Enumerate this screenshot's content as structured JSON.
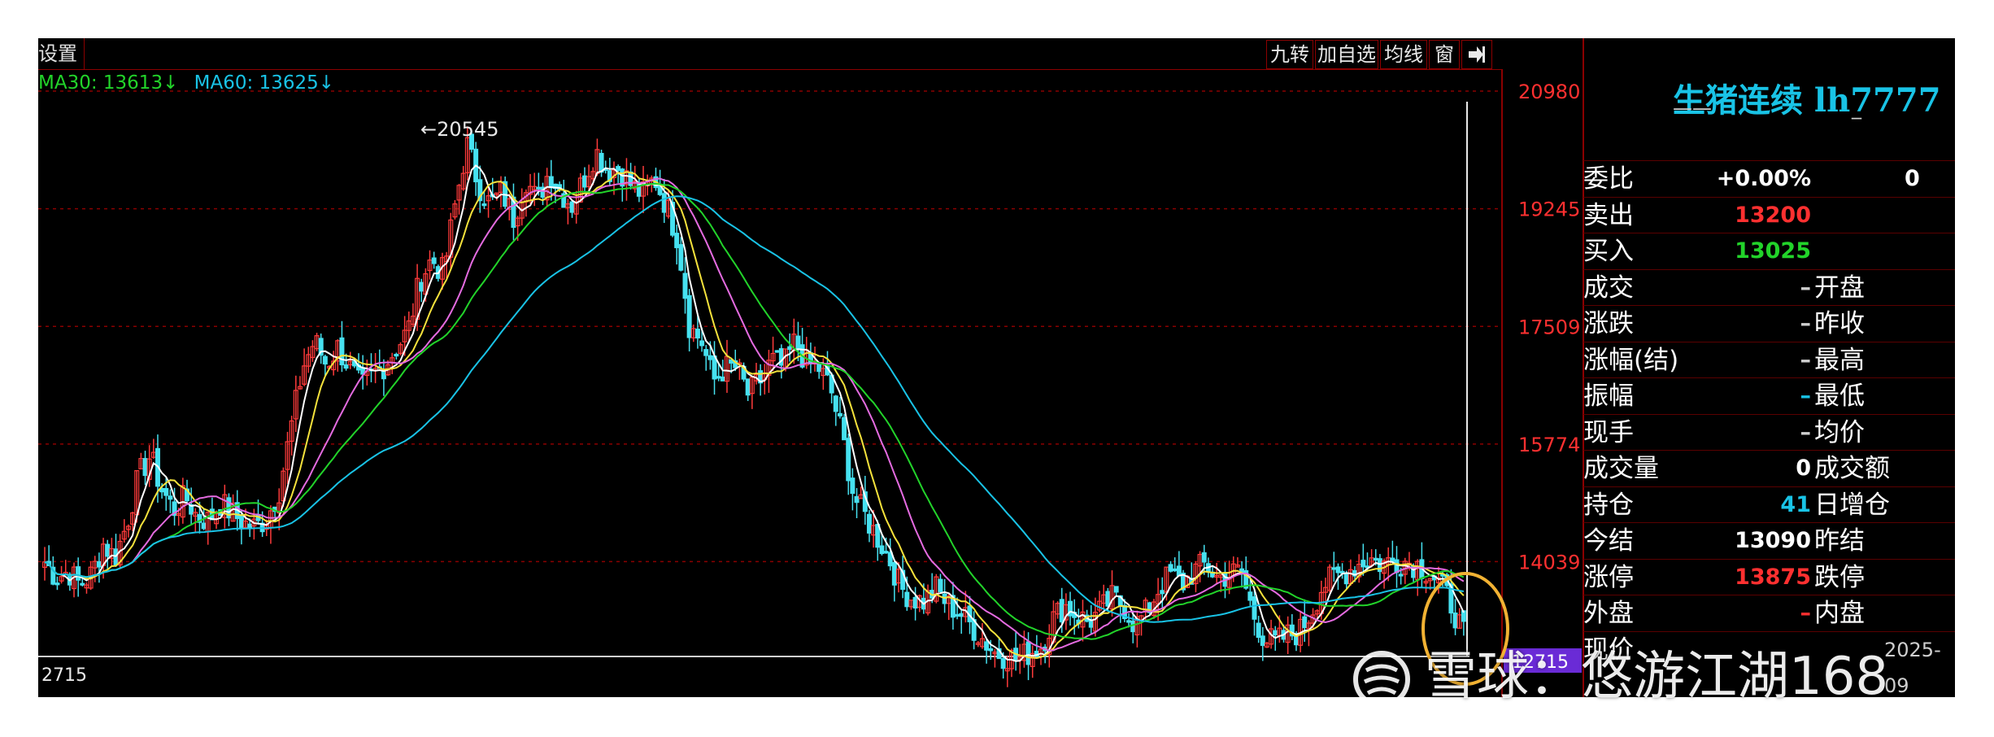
{
  "toolbar": {
    "settings_label": "设置",
    "buttons": [
      "九转",
      "加自选",
      "均线",
      "窗"
    ],
    "arrow_icon": "pin-right-icon"
  },
  "ma_legend": [
    {
      "label": "MA30: 13613↓",
      "color": "#22d32a"
    },
    {
      "label": "MA60: 13625↓",
      "color": "#19c3e6"
    }
  ],
  "peak_label": "20545",
  "bottom_left_label": "2715",
  "quote_panel": {
    "title": "生猪连续 lh7777",
    "dash1": "——",
    "dash2": "_",
    "rows": [
      {
        "label": "委比",
        "value": "+0.00%",
        "value_color": "#ffffff",
        "label2": "",
        "extra": "0"
      },
      {
        "label": "卖出",
        "value": "13200",
        "value_color": "#ff3030",
        "label2": ""
      },
      {
        "label": "买入",
        "value": "13025",
        "value_color": "#22d32a",
        "label2": ""
      },
      {
        "label": "成交",
        "value": "–",
        "value_color": "#cfcfcf",
        "label2": "开盘"
      },
      {
        "label": "涨跌",
        "value": "–",
        "value_color": "#cfcfcf",
        "label2": "昨收"
      },
      {
        "label": "涨幅(结)",
        "value": "–",
        "value_color": "#cfcfcf",
        "label2": "最高"
      },
      {
        "label": "振幅",
        "value": "–",
        "value_color": "#19c3e6",
        "label2": "最低"
      },
      {
        "label": "现手",
        "value": "–",
        "value_color": "#cfcfcf",
        "label2": "均价"
      },
      {
        "label": "成交量",
        "value": "0",
        "value_color": "#ffffff",
        "label2": "成交额"
      },
      {
        "label": "持仓",
        "value": "41",
        "value_color": "#19c3e6",
        "label2": "日增仓"
      },
      {
        "label": "今结",
        "value": "13090",
        "value_color": "#ffffff",
        "label2": "昨结"
      },
      {
        "label": "涨停",
        "value": "13875",
        "value_color": "#ff3030",
        "label2": "跌停"
      },
      {
        "label": "外盘",
        "value": "–",
        "value_color": "#ff3030",
        "label2": "内盘"
      },
      {
        "label": "现价",
        "value": "",
        "value_color": "#ffffff",
        "label2": "2025-09"
      }
    ]
  },
  "watermark": "雪球：悠游江湖168",
  "chart_data": {
    "type": "candlestick",
    "y_ticks": [
      20980,
      19245,
      17509,
      15774,
      14039
    ],
    "ylim": [
      12400,
      21400
    ],
    "grid": "dashed horizontal",
    "last_price_tag": "12715",
    "close_path": [
      14039,
      13800,
      13900,
      13700,
      13850,
      14300,
      14100,
      14600,
      15300,
      15600,
      15100,
      14800,
      15000,
      14700,
      14650,
      14900,
      14750,
      14600,
      14550,
      14700,
      15100,
      16000,
      16900,
      17300,
      16950,
      17200,
      16900,
      16600,
      16800,
      16950,
      17200,
      17450,
      18200,
      18500,
      18300,
      19300,
      20200,
      19600,
      19300,
      19500,
      19100,
      19700,
      19350,
      19800,
      19500,
      19300,
      19700,
      20100,
      19800,
      19850,
      19600,
      19450,
      19700,
      19300,
      18800,
      17500,
      17300,
      16700,
      16900,
      16900,
      16500,
      16700,
      17000,
      16900,
      17300,
      16950,
      16900,
      16600,
      15900,
      15000,
      14700,
      14400,
      14100,
      13650,
      13500,
      13450,
      13650,
      13400,
      13300,
      13100,
      12900,
      12700,
      12650,
      12600,
      12700,
      12800,
      13200,
      13400,
      13250,
      13150,
      13300,
      13500,
      13400,
      13100,
      13300,
      13650,
      13850,
      13700,
      13900,
      14000,
      13800,
      13850,
      13900,
      13300,
      12900,
      12850,
      12950,
      13000,
      13300,
      13700,
      13800,
      13900,
      14000,
      14100,
      14000,
      14050,
      14050,
      14000,
      13900,
      13700,
      13400,
      12950
    ],
    "ma_series": [
      {
        "name": "MA5",
        "color": "#ffffff"
      },
      {
        "name": "MA10",
        "color": "#f5e23c"
      },
      {
        "name": "MA20",
        "color": "#e46be0"
      },
      {
        "name": "MA30",
        "color": "#22d32a"
      },
      {
        "name": "MA60",
        "color": "#19c3e6"
      }
    ],
    "annotation": "yellow circle marking the latest bars"
  }
}
